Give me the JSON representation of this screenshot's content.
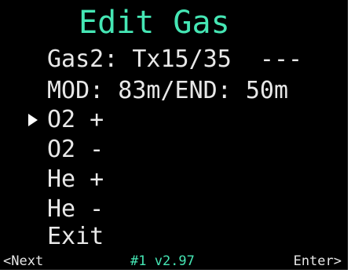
{
  "header": {
    "title": "Edit Gas"
  },
  "info": {
    "gas_line": "Gas2: Tx15/35  ---",
    "mod_line": "MOD: 83m/END: 50m"
  },
  "menu": {
    "items": [
      {
        "label": "O2 +"
      },
      {
        "label": "O2 -"
      },
      {
        "label": "He +"
      },
      {
        "label": "He -"
      },
      {
        "label": "Exit"
      }
    ],
    "selected_index": 0
  },
  "footer": {
    "left": "<Next",
    "center": "#1 v2.97",
    "right": "Enter>"
  },
  "colors": {
    "accent": "#45e6b4",
    "text": "#e8e8e8",
    "background": "#000000"
  },
  "icons": {
    "cursor": "arrow-right-icon"
  }
}
